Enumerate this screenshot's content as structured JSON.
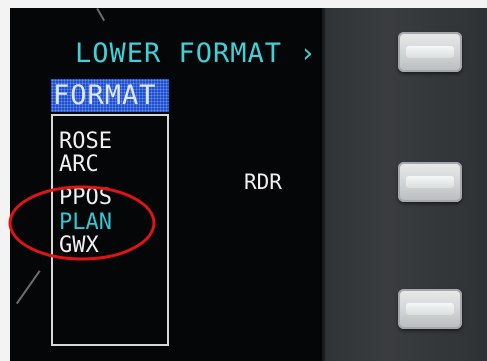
{
  "display": {
    "header": "LOWER FORMAT ›",
    "format_menu": {
      "title": "FORMAT",
      "items": [
        {
          "label": "ROSE",
          "active": false
        },
        {
          "label": "ARC",
          "active": false
        },
        {
          "label": "PPOS",
          "active": false
        },
        {
          "label": "PLAN",
          "active": true
        },
        {
          "label": "GWX",
          "active": false
        }
      ]
    },
    "rdr_label": "RDR"
  },
  "colors": {
    "cyan_text": "#3fd0d8",
    "active_item": "#30c7d6",
    "highlight_box": "#1d4fd1",
    "annotation_ellipse": "#e01414",
    "screen_background": "#050608"
  },
  "line_select_keys": [
    "lsk-top",
    "lsk-middle",
    "lsk-bottom"
  ]
}
